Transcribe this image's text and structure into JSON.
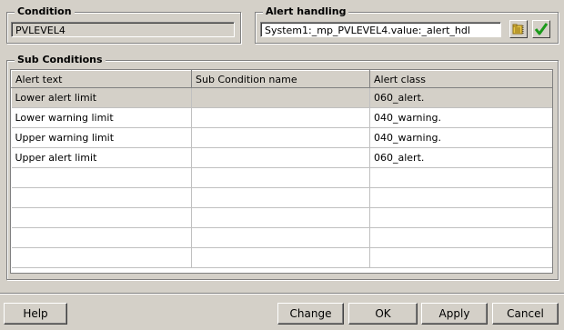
{
  "condition": {
    "title": "Condition",
    "value": "PVLEVEL4"
  },
  "alert_handling": {
    "title": "Alert handling",
    "value": "System1:_mp_PVLEVEL4.value:_alert_hdl",
    "icons": [
      "folder-browse-icon",
      "checkmark-icon"
    ]
  },
  "sub_conditions": {
    "title": "Sub Conditions",
    "columns": [
      "Alert text",
      "Sub Condition name",
      "Alert class"
    ],
    "rows": [
      {
        "alert_text": "Lower alert limit",
        "sub_condition_name": "",
        "alert_class": "060_alert."
      },
      {
        "alert_text": "Lower warning limit",
        "sub_condition_name": "",
        "alert_class": "040_warning."
      },
      {
        "alert_text": "Upper warning limit",
        "sub_condition_name": "",
        "alert_class": "040_warning."
      },
      {
        "alert_text": "Upper alert limit",
        "sub_condition_name": "",
        "alert_class": "060_alert."
      },
      {
        "alert_text": "",
        "sub_condition_name": "",
        "alert_class": ""
      },
      {
        "alert_text": "",
        "sub_condition_name": "",
        "alert_class": ""
      },
      {
        "alert_text": "",
        "sub_condition_name": "",
        "alert_class": ""
      },
      {
        "alert_text": "",
        "sub_condition_name": "",
        "alert_class": ""
      },
      {
        "alert_text": "",
        "sub_condition_name": "",
        "alert_class": ""
      }
    ],
    "selected_row": 0
  },
  "buttons": {
    "help": "Help",
    "change": "Change",
    "ok": "OK",
    "apply": "Apply",
    "cancel": "Cancel"
  },
  "colors": {
    "face": "#d4d0c8",
    "checkmark": "#1a9a1a",
    "folder": "#e8c84a"
  }
}
